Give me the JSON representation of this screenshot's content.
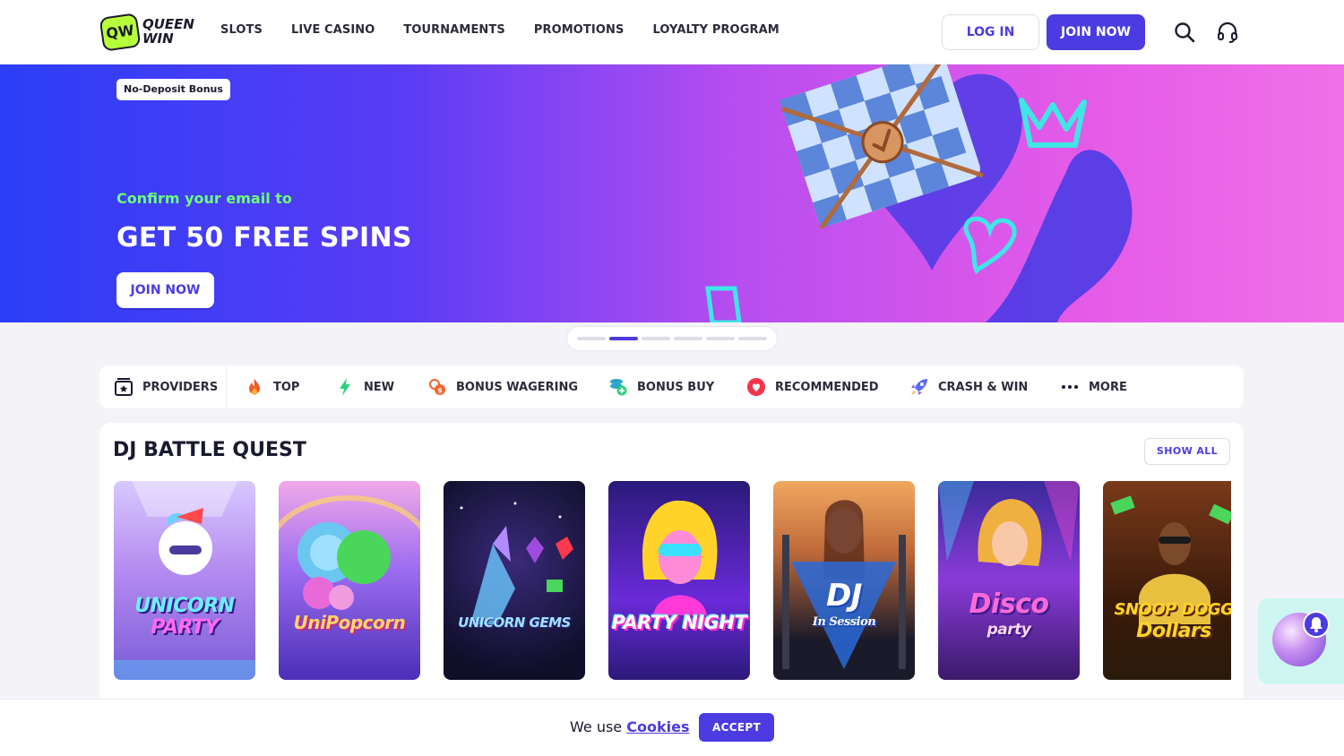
{
  "header": {
    "logo_mark": "QW",
    "logo_line1": "QUEEN",
    "logo_line2": "WIN",
    "nav": [
      "SLOTS",
      "LIVE CASINO",
      "TOURNAMENTS",
      "PROMOTIONS",
      "LOYALTY PROGRAM"
    ],
    "login_label": "LOG IN",
    "join_label": "JOIN NOW",
    "icons": [
      "search-icon",
      "headset-icon"
    ]
  },
  "banner": {
    "badge": "No-Deposit Bonus",
    "subtitle": "Confirm your email to",
    "title": "GET 50 FREE SPINS",
    "cta": "JOIN NOW",
    "slides_total": 6,
    "active_slide": 2
  },
  "categories": {
    "providers": "PROVIDERS",
    "items": [
      {
        "label": "TOP",
        "icon": "fire-icon"
      },
      {
        "label": "NEW",
        "icon": "lightning-icon"
      },
      {
        "label": "BONUS WAGERING",
        "icon": "coin-exchange-icon"
      },
      {
        "label": "BONUS BUY",
        "icon": "coins-plus-icon"
      },
      {
        "label": "RECOMMENDED",
        "icon": "heart-badge-icon"
      },
      {
        "label": "CRASH & WIN",
        "icon": "rocket-icon"
      },
      {
        "label": "MORE",
        "icon": "dots-icon"
      }
    ]
  },
  "section": {
    "title": "DJ BATTLE QUEST",
    "show_all": "SHOW ALL",
    "games": [
      {
        "title_line1": "UNICORN",
        "title_line2": "PARTY"
      },
      {
        "title_line1": "UniPopcorn",
        "title_line2": ""
      },
      {
        "title_line1": "UNICORN GEMS",
        "title_line2": ""
      },
      {
        "title_line1": "PARTY NIGHT",
        "title_line2": ""
      },
      {
        "title_line1": "DJ",
        "title_line2": "In Session"
      },
      {
        "title_line1": "Disco",
        "title_line2": "party"
      },
      {
        "title_line1": "SNOOP DOGG",
        "title_line2": "Dollars"
      }
    ]
  },
  "cookie": {
    "text": "We use",
    "link": "Cookies",
    "accept": "ACCEPT"
  },
  "colors": {
    "accent": "#4a3ce0",
    "promo_green": "#6dff7a",
    "chat_bg": "#cdf6f1"
  }
}
